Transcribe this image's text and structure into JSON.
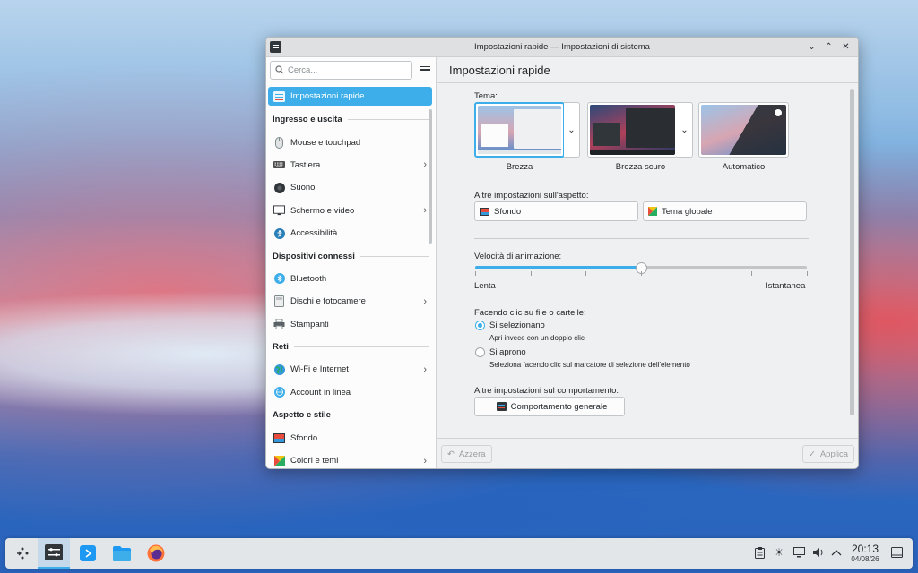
{
  "window": {
    "title": "Impostazioni rapide — Impostazioni di sistema",
    "controls": [
      "chevron-down",
      "chevron-up",
      "close"
    ]
  },
  "sidebar": {
    "search_placeholder": "Cerca...",
    "active_item": "Impostazioni rapide",
    "groups": [
      {
        "header": "Ingresso e uscita",
        "items": [
          {
            "label": "Mouse e touchpad",
            "icon": "mouse-icon",
            "chevron": false
          },
          {
            "label": "Tastiera",
            "icon": "keyboard-icon",
            "chevron": true
          },
          {
            "label": "Suono",
            "icon": "speaker-icon",
            "chevron": false
          },
          {
            "label": "Schermo e video",
            "icon": "monitor-icon",
            "chevron": true
          },
          {
            "label": "Accessibilità",
            "icon": "accessibility-icon",
            "chevron": false
          }
        ]
      },
      {
        "header": "Dispositivi connessi",
        "items": [
          {
            "label": "Bluetooth",
            "icon": "bluetooth-icon",
            "chevron": false
          },
          {
            "label": "Dischi e fotocamere",
            "icon": "disk-icon",
            "chevron": true
          },
          {
            "label": "Stampanti",
            "icon": "printer-icon",
            "chevron": false
          }
        ]
      },
      {
        "header": "Reti",
        "items": [
          {
            "label": "Wi-Fi e Internet",
            "icon": "globe-icon",
            "chevron": true
          },
          {
            "label": "Account in linea",
            "icon": "online-accounts-icon",
            "chevron": false
          }
        ]
      },
      {
        "header": "Aspetto e stile",
        "items": [
          {
            "label": "Sfondo",
            "icon": "wallpaper-icon",
            "chevron": false
          },
          {
            "label": "Colori e temi",
            "icon": "colors-icon",
            "chevron": true
          }
        ]
      }
    ]
  },
  "main": {
    "header": "Impostazioni rapide",
    "theme_label": "Tema:",
    "themes": [
      {
        "name": "Brezza",
        "selected": true
      },
      {
        "name": "Brezza scuro",
        "selected": false
      },
      {
        "name": "Automatico",
        "selected": false
      }
    ],
    "appearance_label": "Altre impostazioni sull'aspetto:",
    "appearance_buttons": [
      "Sfondo",
      "Tema globale"
    ],
    "animation_label": "Velocità di animazione:",
    "animation_min": "Lenta",
    "animation_max": "Istantanea",
    "animation_value": 0.5,
    "click_label": "Facendo clic su file o cartelle:",
    "click_options": [
      {
        "title": "Si selezionano",
        "desc": "Apri invece con un doppio clic",
        "checked": true
      },
      {
        "title": "Si aprono",
        "desc": "Seleziona facendo clic sul marcatore di selezione dell'elemento",
        "checked": false
      }
    ],
    "behavior_label": "Altre impostazioni sul comportamento:",
    "behavior_button": "Comportamento generale"
  },
  "footer": {
    "reset": "Azzera",
    "apply": "Applica"
  },
  "taskbar": {
    "time": "20:13",
    "date": "04/08/26"
  },
  "colors": {
    "accent": "#3daee9",
    "window_bg": "#eff0f1",
    "text": "#232629"
  }
}
